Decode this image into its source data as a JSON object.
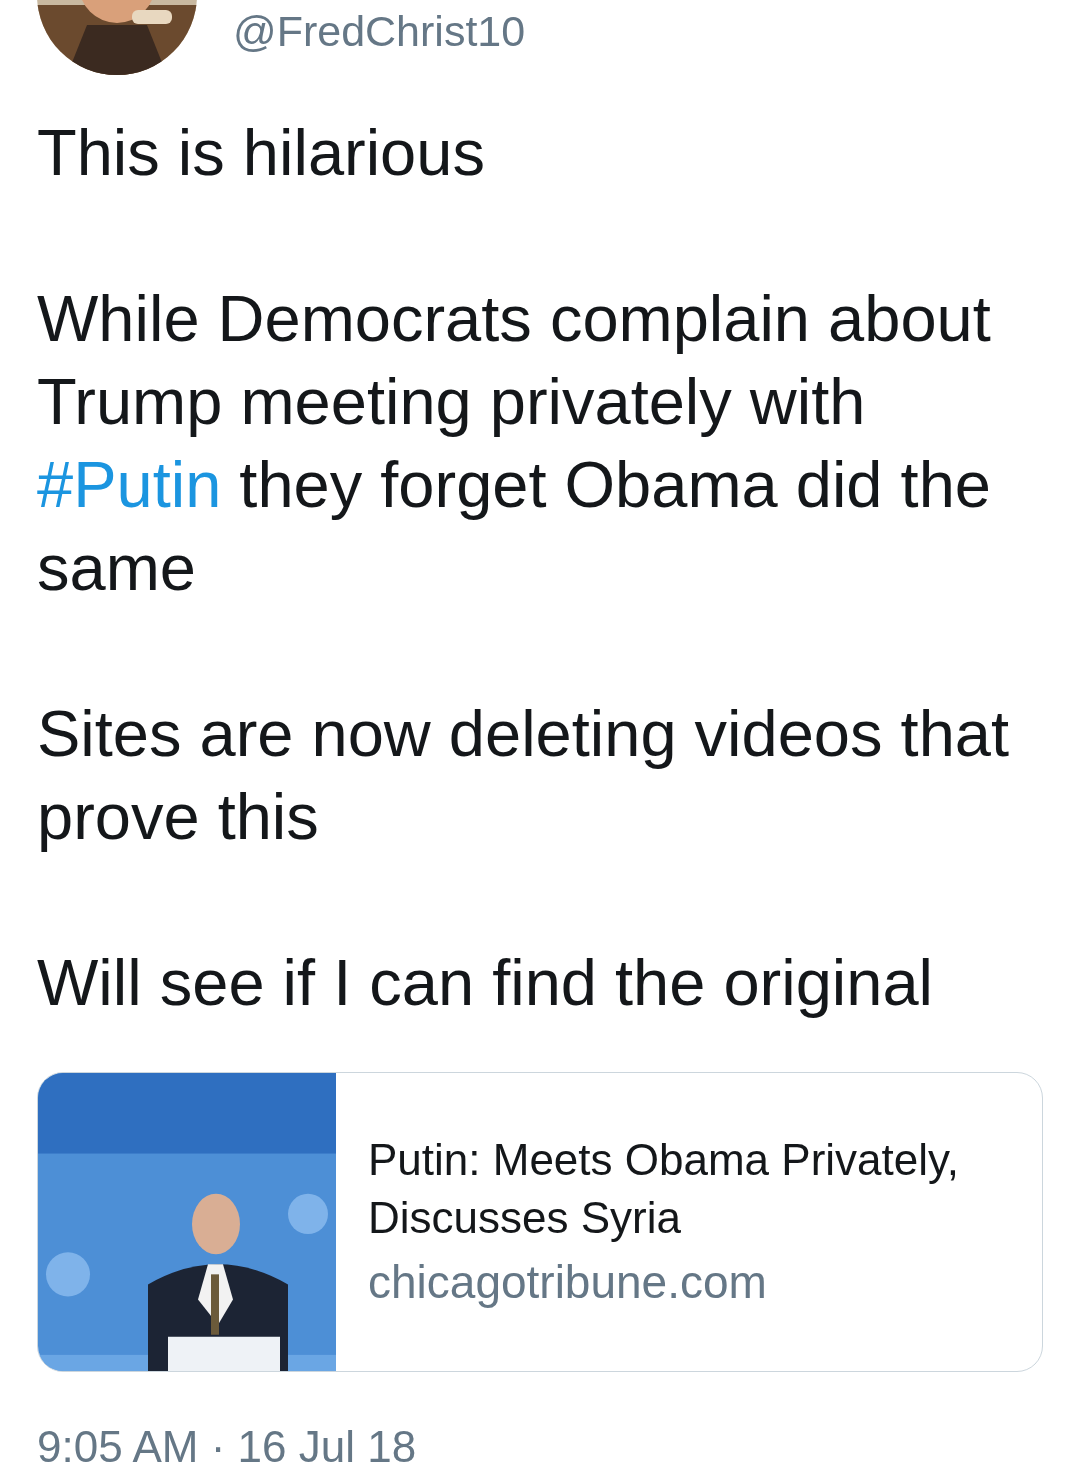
{
  "author": {
    "handle": "@FredChrist10"
  },
  "tweet": {
    "paragraphs": [
      {
        "parts": [
          {
            "kind": "text",
            "text": "This is hilarious"
          }
        ]
      },
      {
        "parts": [
          {
            "kind": "text",
            "text": "While Democrats complain about Trump meeting privately with "
          },
          {
            "kind": "hashtag",
            "text": "#Putin"
          },
          {
            "kind": "text",
            "text": " they forget Obama did the same"
          }
        ]
      },
      {
        "parts": [
          {
            "kind": "text",
            "text": "Sites are now deleting videos that prove this"
          }
        ]
      },
      {
        "parts": [
          {
            "kind": "text",
            "text": "Will see if I can find the original"
          }
        ]
      }
    ]
  },
  "link_card": {
    "title": "Putin: Meets Obama Privately, Discusses Syria",
    "domain": "chicagotribune.com"
  },
  "timestamp": "9:05 AM · 16 Jul 18"
}
